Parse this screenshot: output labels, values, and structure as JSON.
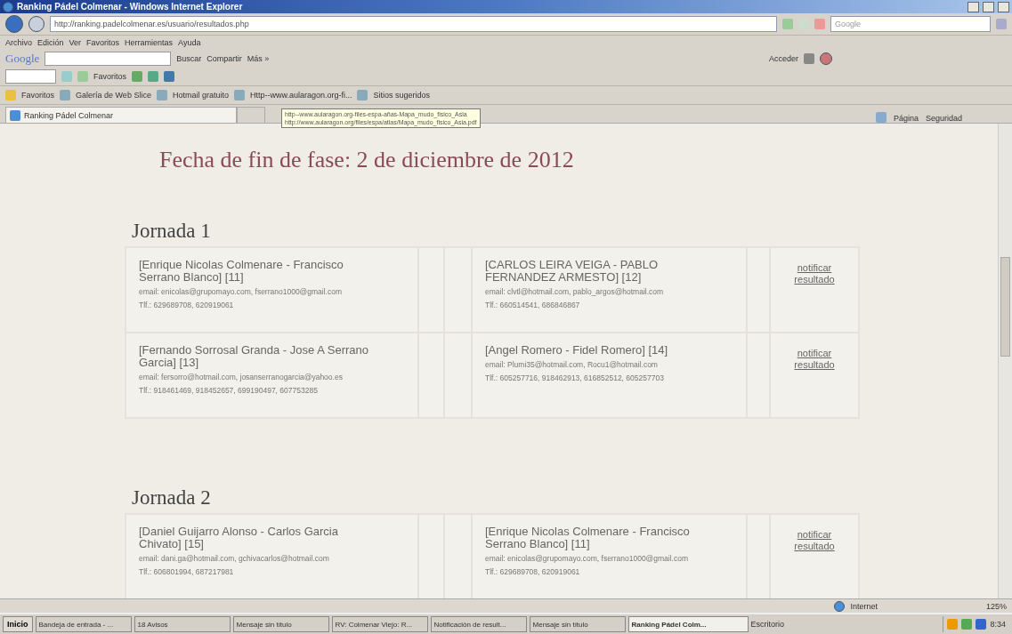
{
  "window": {
    "title": "Ranking Pádel Colmenar - Windows Internet Explorer"
  },
  "address_bar": {
    "url": "http://ranking.padelcolmenar.es/usuario/resultados.php"
  },
  "search_box": {
    "placeholder": "Google"
  },
  "menu": [
    "Archivo",
    "Edición",
    "Ver",
    "Favoritos",
    "Herramientas",
    "Ayuda"
  ],
  "google_toolbar": {
    "logo": "Google",
    "buttons": [
      "Buscar",
      "Compartir",
      "Más »"
    ],
    "sign_in": "Acceder"
  },
  "toolbar_2": {
    "favorites": "Favoritos"
  },
  "favorites_bar": {
    "title": "Favoritos",
    "links": [
      "Galería de Web Slice",
      "Hotmail gratuito",
      "Http--www.aularagon.org-fi...",
      "Sitios sugeridos"
    ]
  },
  "tabs": [
    {
      "label": "Ranking Pádel Colmenar",
      "selected": true
    }
  ],
  "command_bar": [
    "Página",
    "Seguridad"
  ],
  "tooltip": [
    "http--www.aularagon.org-files-espa-añas-Mapa_mudo_fisico_Asia",
    "http://www.aularagon.org/files/espa/atlas/Mapa_mudo_fisico_Asia.pdf"
  ],
  "page": {
    "deadline": "Fecha de fin de fase: 2 de diciembre de 2012",
    "rounds": [
      {
        "title": "Jornada 1",
        "matches": [
          {
            "team_1": {
              "name": "[Enrique Nicolas Colmenare - Francisco Serrano Blanco] [11]",
              "email": "email: enicolas@grupomayo.com, fserrano1000@gmail.com",
              "phone": "Tlf.: 629689708, 620919061"
            },
            "team_2": {
              "name": "[CARLOS LEIRA VEIGA - PABLO FERNANDEZ ARMESTO] [12]",
              "email": "email: clvtl@hotmail.com, pablo_argos@hotmail.com",
              "phone": "Tlf.: 660514541, 686846867"
            },
            "action": "notificar resultado"
          },
          {
            "team_1": {
              "name": "[Fernando Sorrosal Granda - Jose A Serrano Garcia] [13]",
              "email": "email: fersorro@hotmail.com, josanserranogarcia@yahoo.es",
              "phone": "Tlf.: 918461469, 918452657, 699190497, 607753285"
            },
            "team_2": {
              "name": "[Angel Romero - Fidel Romero] [14]",
              "email": "email: Plumi35@hotmail.com, Rocu1@hotmail.com",
              "phone": "Tlf.: 605257716, 918462913, 616852512, 605257703"
            },
            "action": "notificar resultado"
          }
        ]
      },
      {
        "title": "Jornada 2",
        "matches": [
          {
            "team_1": {
              "name": "[Daniel Guijarro Alonso - Carlos Garcia Chivato] [15]",
              "email": "email: dani.ga@hotmail.com, gchivacarlos@hotmail.com",
              "phone": "Tlf.: 606801994, 687217981"
            },
            "team_2": {
              "name": "[Enrique Nicolas Colmenare - Francisco Serrano Blanco] [11]",
              "email": "email: enicolas@grupomayo.com, fserrano1000@gmail.com",
              "phone": "Tlf.: 629689708, 620919061"
            },
            "action": "notificar resultado"
          }
        ]
      }
    ]
  },
  "status_bar": {
    "zone": "Internet",
    "zoom": "125%"
  },
  "taskbar": {
    "start": "Inicio",
    "items": [
      {
        "label": "Bandeja de entrada - ...",
        "selected": false
      },
      {
        "label": "18 Avisos",
        "selected": false
      },
      {
        "label": "Mensaje sin título",
        "selected": false
      },
      {
        "label": "RV: Colmenar Viejo: R...",
        "selected": false
      },
      {
        "label": "Notificación de result...",
        "selected": false
      },
      {
        "label": "Mensaje sin título",
        "selected": false
      },
      {
        "label": "Ranking Pádel Colm...",
        "selected": true
      }
    ],
    "desktop": "Escritorio",
    "clock": "8:34"
  }
}
